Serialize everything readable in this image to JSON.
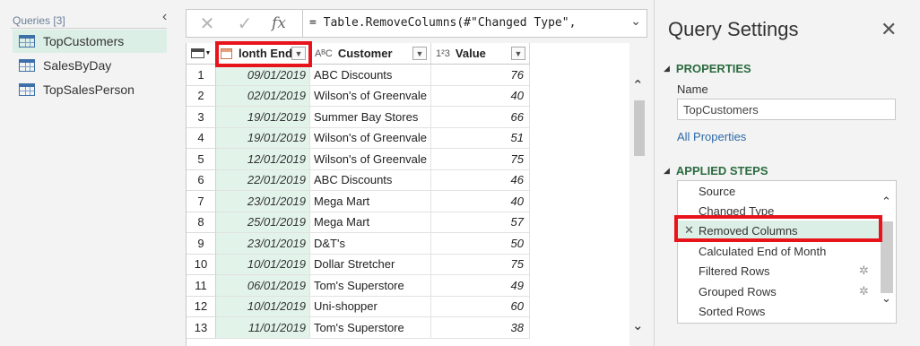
{
  "queries": {
    "header": "Queries [3]",
    "items": [
      {
        "label": "TopCustomers"
      },
      {
        "label": "SalesByDay"
      },
      {
        "label": "TopSalesPerson"
      }
    ]
  },
  "formula_bar": {
    "cancel_glyph": "✕",
    "confirm_glyph": "✓",
    "fx_label": "fx",
    "formula": "= Table.RemoveColumns(#\"Changed Type\","
  },
  "grid": {
    "columns": [
      {
        "label": "lonth End",
        "type_glyph": ""
      },
      {
        "label": "Customer",
        "type_glyph": "AᴮC"
      },
      {
        "label": "Value",
        "type_glyph": "1²3"
      }
    ],
    "rows": [
      {
        "n": "1",
        "date": "09/01/2019",
        "customer": "ABC Discounts",
        "value": "76"
      },
      {
        "n": "2",
        "date": "02/01/2019",
        "customer": "Wilson's of Greenvale",
        "value": "40"
      },
      {
        "n": "3",
        "date": "19/01/2019",
        "customer": "Summer Bay Stores",
        "value": "66"
      },
      {
        "n": "4",
        "date": "19/01/2019",
        "customer": "Wilson's of Greenvale",
        "value": "51"
      },
      {
        "n": "5",
        "date": "12/01/2019",
        "customer": "Wilson's of Greenvale",
        "value": "75"
      },
      {
        "n": "6",
        "date": "22/01/2019",
        "customer": "ABC Discounts",
        "value": "46"
      },
      {
        "n": "7",
        "date": "23/01/2019",
        "customer": "Mega Mart",
        "value": "40"
      },
      {
        "n": "8",
        "date": "25/01/2019",
        "customer": "Mega Mart",
        "value": "57"
      },
      {
        "n": "9",
        "date": "23/01/2019",
        "customer": "D&T's",
        "value": "50"
      },
      {
        "n": "10",
        "date": "10/01/2019",
        "customer": "Dollar Stretcher",
        "value": "75"
      },
      {
        "n": "11",
        "date": "06/01/2019",
        "customer": "Tom's Superstore",
        "value": "49"
      },
      {
        "n": "12",
        "date": "10/01/2019",
        "customer": "Uni-shopper",
        "value": "60"
      },
      {
        "n": "13",
        "date": "11/01/2019",
        "customer": "Tom's Superstore",
        "value": "38"
      }
    ]
  },
  "settings": {
    "title": "Query Settings",
    "properties_header": "PROPERTIES",
    "name_label": "Name",
    "name_value": "TopCustomers",
    "all_properties_link": "All Properties",
    "applied_steps_header": "APPLIED STEPS",
    "steps": [
      {
        "label": "Source"
      },
      {
        "label": "Changed Type"
      },
      {
        "label": "Removed Columns"
      },
      {
        "label": "Calculated End of Month"
      },
      {
        "label": "Filtered Rows"
      },
      {
        "label": "Grouped Rows"
      },
      {
        "label": "Sorted Rows"
      }
    ]
  },
  "colors": {
    "accent_green": "#2b6b3f",
    "selection": "#dcefe6",
    "highlight_red": "#e8141c",
    "link_blue": "#2e6aa8"
  }
}
